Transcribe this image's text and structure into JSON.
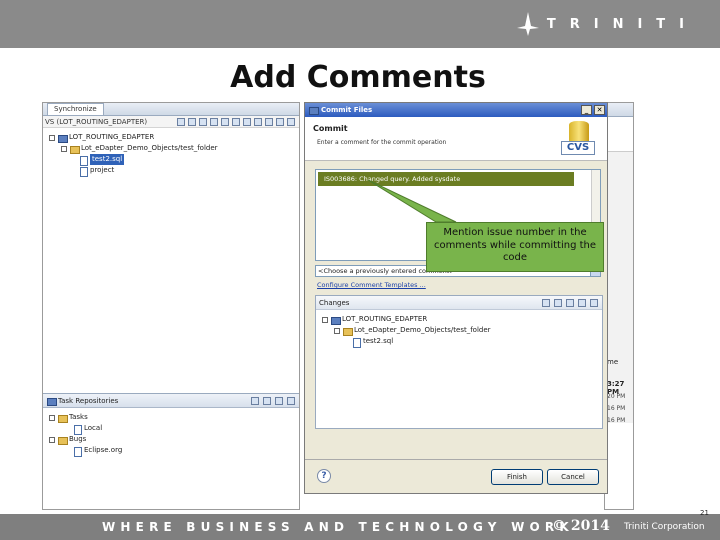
{
  "header": {
    "brand": "TRINITI"
  },
  "slide": {
    "title": "Add Comments"
  },
  "eclipse": {
    "tab": "Synchronize",
    "title_line": "VS (LOT_ROUTING_EDAPTER)",
    "tree": [
      {
        "label": "LOT_ROUTING_EDAPTER"
      },
      {
        "label": "Lot_eDapter_Demo_Objects/test_folder"
      },
      {
        "label": "test2.sql"
      },
      {
        "label": "project"
      }
    ],
    "task_panel": {
      "title": "Task Repositories",
      "items": [
        {
          "label": "Tasks"
        },
        {
          "label": "Local"
        },
        {
          "label": "Bugs"
        },
        {
          "label": "Eclipse.org"
        }
      ]
    },
    "right_strip": {
      "me_label": "me",
      "time": "3:27 PM",
      "times": [
        "20 PM",
        "16 PM",
        "16 PM"
      ]
    }
  },
  "dialog": {
    "title": "Commit Files",
    "close": "✕",
    "heading": "Commit",
    "subheading": "Enter a comment for the commit operation",
    "cvs": "CVS",
    "comment": "IS003686: Changed query. Added sysdate",
    "previous_combo": "<Choose a previously entered comment>",
    "configure_link": "Configure Comment Templates ...",
    "changes_label": "Changes",
    "changes_tree": [
      {
        "label": "LOT_ROUTING_EDAPTER"
      },
      {
        "label": "Lot_eDapter_Demo_Objects/test_folder"
      },
      {
        "label": "test2.sql"
      }
    ],
    "help": "?",
    "finish": "Finish",
    "cancel": "Cancel"
  },
  "callout": {
    "text": "Mention issue number in the comments while committing the code"
  },
  "footer": {
    "tagline": "WHERE BUSINESS AND TECHNOLOGY WORK",
    "copyright": "© 2014",
    "corporation": "Triniti Corporation",
    "page": "21"
  },
  "colors": {
    "band": "#8a8a8a",
    "callout": "#79b44b",
    "comment_highlight": "#6b7d22"
  }
}
